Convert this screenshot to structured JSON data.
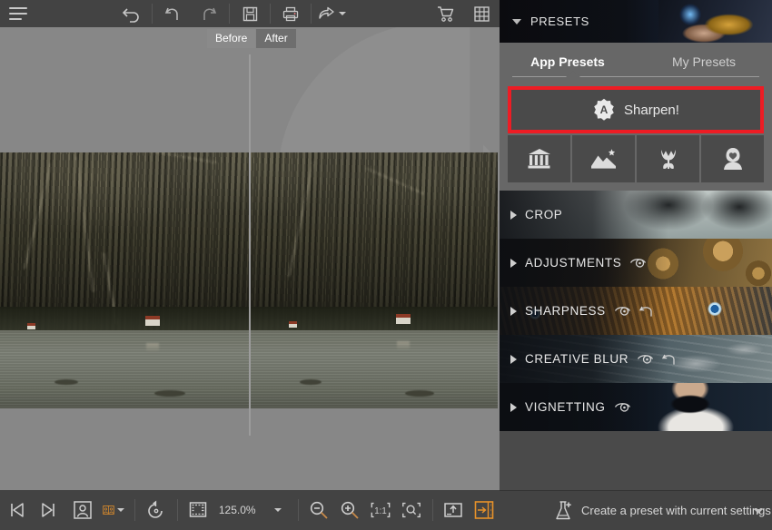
{
  "app": {
    "accent_orange": "#E8922A",
    "highlight_red": "#ED1C24",
    "panel_bg": "#4A4A4A",
    "toolbar_bg": "#434343",
    "canvas_bg": "#878787"
  },
  "toolbar": {
    "menu_label": "Menu",
    "items": [
      {
        "name": "undo-all-icon",
        "label": "Undo All"
      },
      {
        "name": "undo-icon",
        "label": "Undo"
      },
      {
        "name": "redo-icon",
        "label": "Redo"
      },
      {
        "name": "save-icon",
        "label": "Save"
      },
      {
        "name": "print-icon",
        "label": "Print"
      },
      {
        "name": "share-icon",
        "label": "Share"
      },
      {
        "name": "cart-icon",
        "label": "Shop"
      },
      {
        "name": "grid-icon",
        "label": "Browser"
      }
    ]
  },
  "canvas": {
    "before_label": "Before",
    "after_label": "After",
    "selected_view": "Before"
  },
  "bottombar": {
    "prev_label": "Previous Image",
    "next_label": "Next Image",
    "single_view_label": "Single View",
    "split_view_label": "Split View",
    "rotate_label": "Rotate",
    "crop_overlay_label": "Crop Overlay",
    "zoom_value": "125.0%",
    "zoom_out_label": "Zoom Out",
    "zoom_in_label": "Zoom In",
    "one_to_one_label": "1:1",
    "fit_label": "Fit to Screen",
    "export_label": "Export",
    "toggle_panel_label": "Toggle Panel"
  },
  "presets": {
    "header_title": "PRESETS",
    "tabs": [
      {
        "label": "App Presets",
        "active": true
      },
      {
        "label": "My Presets",
        "active": false
      }
    ],
    "sharpen": {
      "label": "Sharpen!",
      "badge": "A",
      "highlighted": true
    },
    "categories": [
      {
        "name": "architecture-icon",
        "label": "Architecture"
      },
      {
        "name": "landscape-icon",
        "label": "Landscape"
      },
      {
        "name": "nature-icon",
        "label": "Nature"
      },
      {
        "name": "portrait-icon",
        "label": "Portrait"
      }
    ]
  },
  "sections": [
    {
      "name": "CROP",
      "has_eye": false,
      "has_reset": false
    },
    {
      "name": "ADJUSTMENTS",
      "has_eye": true,
      "has_reset": false
    },
    {
      "name": "SHARPNESS",
      "has_eye": true,
      "has_reset": true
    },
    {
      "name": "CREATIVE BLUR",
      "has_eye": true,
      "has_reset": true
    },
    {
      "name": "VIGNETTING",
      "has_eye": true,
      "has_reset": false
    }
  ],
  "right_bottom": {
    "label": "Create a preset with current settings"
  }
}
